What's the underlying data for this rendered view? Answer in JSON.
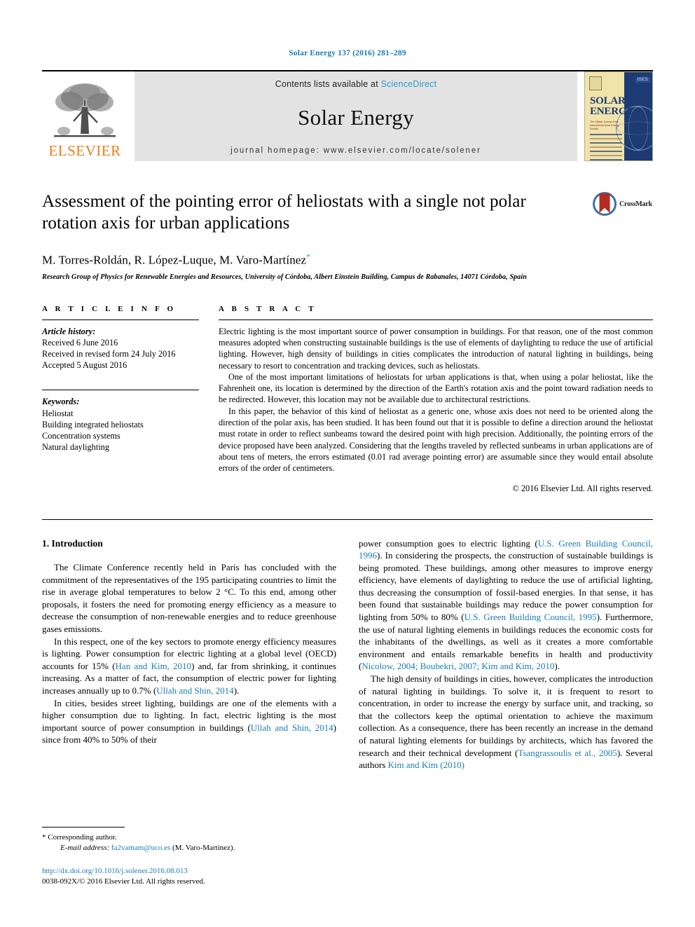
{
  "running_head": "Solar Energy 137 (2016) 281–289",
  "masthead": {
    "publisher_name": "ELSEVIER",
    "contents_prefix": "Contents lists available at ",
    "contents_link": "ScienceDirect",
    "journal_title": "Solar Energy",
    "homepage": "journal homepage: www.elsevier.com/locate/solener",
    "cover": {
      "title_line1": "SOLAR",
      "title_line2": "ENERGY",
      "society_badge": "ISES",
      "subtitle": "The Official Journal of the International Solar Energy Society"
    }
  },
  "article": {
    "title": "Assessment of the pointing error of heliostats with a single not polar rotation axis for urban applications",
    "authors": "M. Torres-Roldán, R. López-Luque, M. Varo-Martínez",
    "corresponding_marker": "*",
    "affiliation": "Research Group of Physics for Renewable Energies and Resources, University of Córdoba, Albert Einstein Building, Campus de Rabanales, 14071 Córdoba, Spain",
    "crossmark_label": "CrossMark"
  },
  "article_info": {
    "heading": "A R T I C L E   I N F O",
    "history_label": "Article history:",
    "history": [
      "Received 6 June 2016",
      "Received in revised form 24 July 2016",
      "Accepted 5 August 2016"
    ],
    "keywords_label": "Keywords:",
    "keywords": [
      "Heliostat",
      "Building integrated heliostats",
      "Concentration systems",
      "Natural daylighting"
    ]
  },
  "abstract": {
    "heading": "A B S T R A C T",
    "paragraphs": [
      "Electric lighting is the most important source of power consumption in buildings. For that reason, one of the most common measures adopted when constructing sustainable buildings is the use of elements of daylighting to reduce the use of artificial lighting. However, high density of buildings in cities complicates the introduction of natural lighting in buildings, being necessary to resort to concentration and tracking devices, such as heliostats.",
      "One of the most important limitations of heliostats for urban applications is that, when using a polar heliostat, like the Fahrenheit one, its location is determined by the direction of the Earth's rotation axis and the point toward radiation needs to be redirected. However, this location may not be available due to architectural restrictions.",
      "In this paper, the behavior of this kind of heliostat as a generic one, whose axis does not need to be oriented along the direction of the polar axis, has been studied. It has been found out that it is possible to define a direction around the heliostat must rotate in order to reflect sunbeams toward the desired point with high precision. Additionally, the pointing errors of the device proposed have been analyzed. Considering that the lengths traveled by reflected sunbeams in urban applications are of about tens of meters, the errors estimated (0.01 rad average pointing error) are assumable since they would entail absolute errors of the order of centimeters."
    ],
    "copyright": "© 2016 Elsevier Ltd. All rights reserved."
  },
  "introduction": {
    "heading": "1. Introduction",
    "left_column": {
      "p1": "The Climate Conference recently held in Paris has concluded with the commitment of the representatives of the 195 participating countries to limit the rise in average global temperatures to below 2 °C. To this end, among other proposals, it fosters the need for promoting energy efficiency as a measure to decrease the consumption of non-renewable energies and to reduce greenhouse gases emissions.",
      "p2_a": "In this respect, one of the key sectors to promote energy efficiency measures is lighting. Power consumption for electric lighting at a global level (OECD) accounts for 15% (",
      "p2_cite1": "Han and Kim, 2010",
      "p2_b": ") and, far from shrinking, it continues increasing. As a matter of fact, the consumption of electric power for lighting increases annually up to 0.7% (",
      "p2_cite2": "Ullah and Shin, 2014",
      "p2_c": ").",
      "p3_a": "In cities, besides street lighting, buildings are one of the elements with a higher consumption due to lighting. In fact, electric lighting is the most important source of power consumption in buildings (",
      "p3_cite1": "Ullah and Shin, 2014",
      "p3_b": ") since from 40% to 50% of their"
    },
    "right_column": {
      "p1_a": "power consumption goes to electric lighting (",
      "p1_cite1": "U.S. Green Building Council, 1996",
      "p1_b": "). In considering the prospects, the construction of sustainable buildings is being promoted. These buildings, among other measures to improve energy efficiency, have elements of daylighting to reduce the use of artificial lighting, thus decreasing the consumption of fossil-based energies. In that sense, it has been found that sustainable buildings may reduce the power consumption for lighting from 50% to 80% (",
      "p1_cite2": "U.S. Green Building Council, 1995",
      "p1_c": "). Furthermore, the use of natural lighting elements in buildings reduces the economic costs for the inhabitants of the dwellings, as well as it creates a more comfortable environment and entails remarkable benefits in health and productivity (",
      "p1_cite3": "Nicolow, 2004; Boubekri, 2007; Kim and Kim, 2010",
      "p1_d": ").",
      "p2_a": "The high density of buildings in cities, however, complicates the introduction of natural lighting in buildings. To solve it, it is frequent to resort to concentration, in order to increase the energy by surface unit, and tracking, so that the collectors keep the optimal orientation to achieve the maximum collection. As a consequence, there has been recently an increase in the demand of natural lighting elements for buildings by architects, which has favored the research and their technical development (",
      "p2_cite1": "Tsangrassoulis et al., 2005",
      "p2_b": "). Several authors ",
      "p2_cite2": "Kim and Kim (2010)"
    }
  },
  "footer": {
    "corresponding_marker": "*",
    "corresponding_label": "Corresponding author.",
    "email_label": "E-mail address:",
    "email": "fa2vamam@uco.es",
    "email_suffix": "(M. Varo-Martínez).",
    "doi": "http://dx.doi.org/10.1016/j.solener.2016.08.013",
    "issn_line": "0038-092X/© 2016 Elsevier Ltd. All rights reserved."
  },
  "colors": {
    "link_blue": "#1a7db6",
    "sciencedirect_blue": "#2e9ad0",
    "elsevier_orange": "#f07c18",
    "crossmark_red": "#b42a20",
    "crossmark_blue": "#3f6fa8"
  }
}
